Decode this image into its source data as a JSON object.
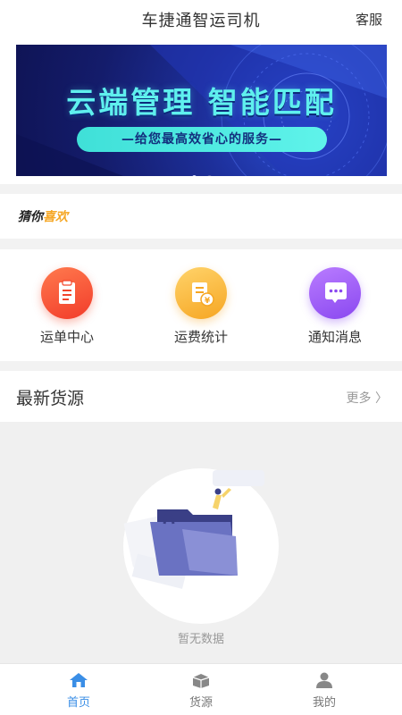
{
  "header": {
    "title": "车捷通智运司机",
    "service": "客服"
  },
  "banner": {
    "headline": "云端管理 智能匹配",
    "subline": "—给您最高效省心的服务—",
    "pages": 2,
    "active_page": 1
  },
  "guess": {
    "part1": "猜你",
    "part2": "喜欢"
  },
  "shortcuts": [
    {
      "label": "运单中心",
      "icon": "clipboard-icon"
    },
    {
      "label": "运费统计",
      "icon": "freight-stats-icon"
    },
    {
      "label": "通知消息",
      "icon": "message-icon"
    }
  ],
  "latest": {
    "title": "最新货源",
    "more": "更多 〉"
  },
  "empty": {
    "text": "暂无数据"
  },
  "tabs": [
    {
      "label": "首页",
      "icon": "home-icon",
      "active": true
    },
    {
      "label": "货源",
      "icon": "cargo-icon",
      "active": false
    },
    {
      "label": "我的",
      "icon": "user-icon",
      "active": false
    }
  ],
  "colors": {
    "accent": "#3a8ee6",
    "banner_text": "#5ff0ee"
  }
}
